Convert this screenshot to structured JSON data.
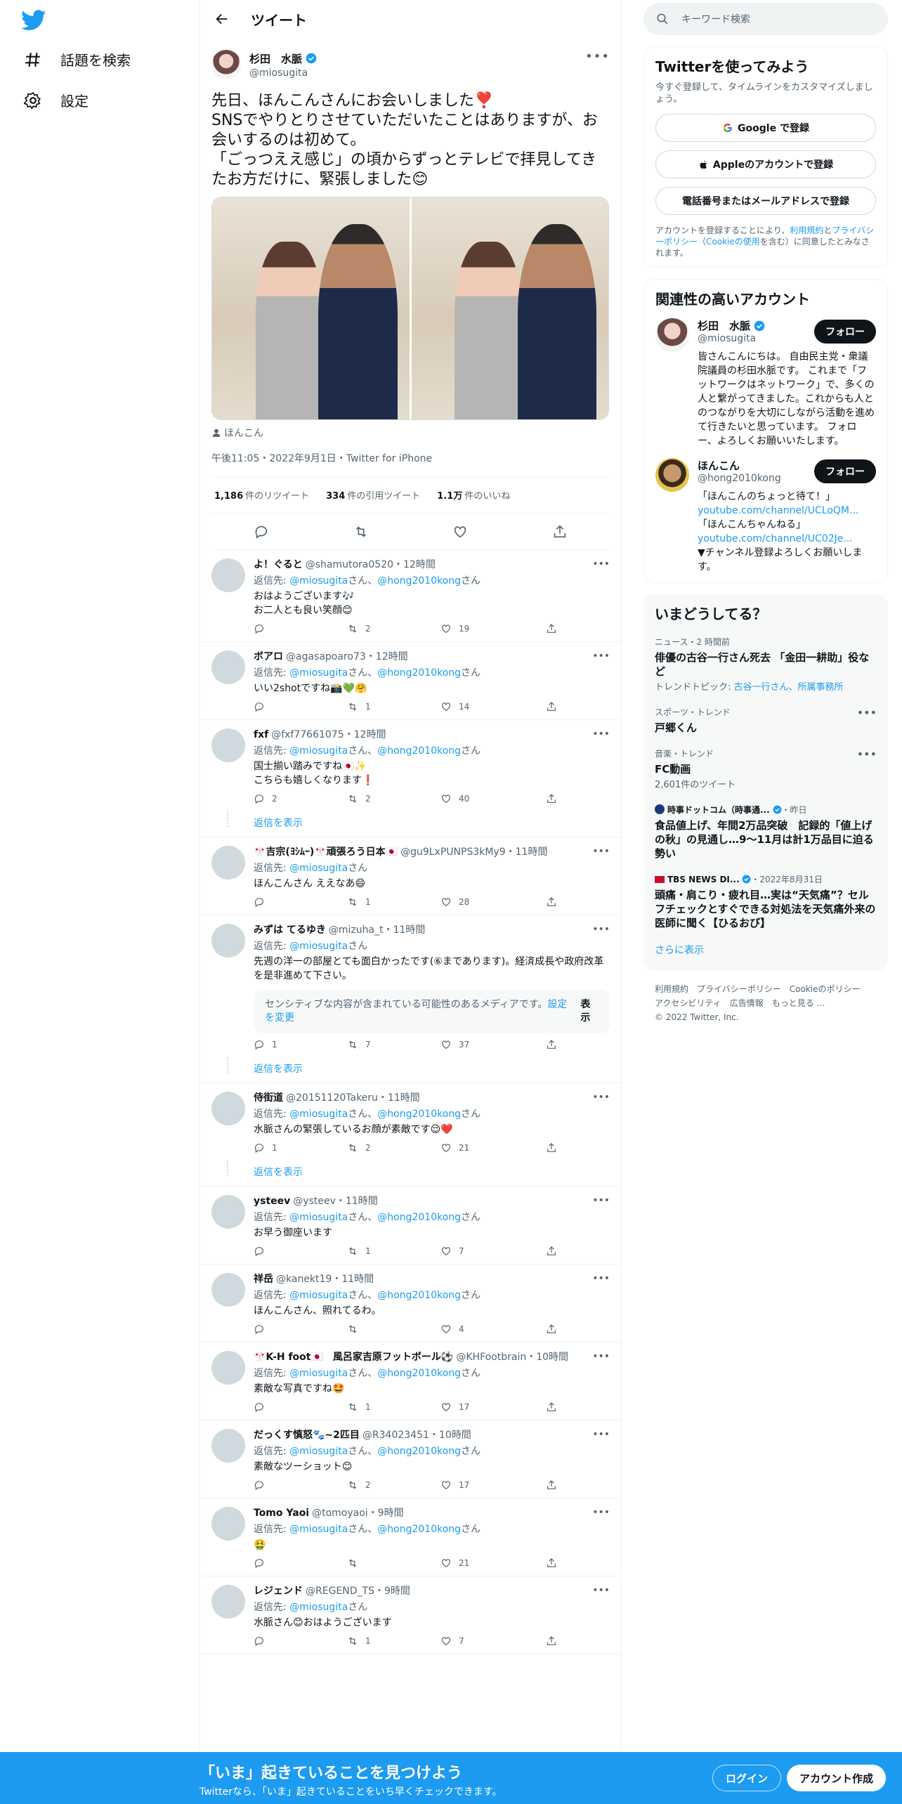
{
  "nav": {
    "explore": "話題を検索",
    "settings": "設定"
  },
  "header": {
    "title": "ツイート"
  },
  "main_tweet": {
    "name": "杉田　水脈",
    "handle": "@miosugita",
    "text": "先日、ほんこんさんにお会いしました❣️\nSNSでやりとりさせていただいたことはありますが、お会いするのは初めて。\n「ごっつええ感じ」の頃からずっとテレビで拝見してきたお方だけに、緊張しました😊",
    "tag": "ほんこん",
    "timestamp": "午後11:05・2022年9月1日・Twitter for iPhone",
    "retweets_num": "1,186",
    "retweets_label": "件のリツイート",
    "quotes_num": "334",
    "quotes_label": "件の引用ツイート",
    "likes_num": "1.1万",
    "likes_label": "件のいいね"
  },
  "replies": [
    {
      "name": "よ！ぐると",
      "handle": "@shamutora0520",
      "time": "・12時間",
      "to_prefix": "返信先:",
      "to1": "@miosugita",
      "to_sep": "さん、",
      "to2": "@hong2010kong",
      "to_suffix": "さん",
      "text": "おはようございます🎶\nお二人とも良い笑顔😊",
      "replies": "",
      "retweets": "2",
      "likes": "19"
    },
    {
      "name": "ボアロ",
      "handle": "@agasapoaro73",
      "time": "・12時間",
      "to_prefix": "返信先:",
      "to1": "@miosugita",
      "to_sep": "さん、",
      "to2": "@hong2010kong",
      "to_suffix": "さん",
      "text": "いい2shotですね📸💚🤗",
      "replies": "",
      "retweets": "1",
      "likes": "14"
    },
    {
      "name": "fxf",
      "handle": "@fxf77661075",
      "time": "・12時間",
      "to_prefix": "返信先:",
      "to1": "@miosugita",
      "to_sep": "さん、",
      "to2": "@hong2010kong",
      "to_suffix": "さん",
      "text": "国士揃い踏みですね🇯🇵✨\nこちらも嬉しくなります❗️",
      "replies": "2",
      "retweets": "2",
      "likes": "40",
      "show_more": "返信を表示"
    },
    {
      "name": "🎌吉宗(ﾖｼﾑｰ)🎌頑張ろう日本🇯🇵",
      "handle": "@gu9LxPUNPS3kMy9",
      "time": "・11時間",
      "to_prefix": "返信先:",
      "to1": "@miosugita",
      "to_suffix": "さん",
      "text": "ほんこんさん ええなあ😄",
      "replies": "",
      "retweets": "1",
      "likes": "28"
    },
    {
      "name": "みずは てるゆき",
      "handle": "@mizuha_t",
      "time": "・11時間",
      "to_prefix": "返信先:",
      "to1": "@miosugita",
      "to_suffix": "さん",
      "text": "先週の洋一の部屋とても面白かったです(⑥まであります)。経済成長や政府改革を是非進めて下さい。",
      "sensitive_text": "センシティブな内容が含まれている可能性のあるメディアです。",
      "sensitive_link": "設定を変更",
      "sensitive_btn": "表示",
      "replies": "1",
      "retweets": "7",
      "likes": "37",
      "show_more": "返信を表示"
    },
    {
      "name": "侍街道",
      "handle": "@20151120Takeru",
      "time": "・11時間",
      "to_prefix": "返信先:",
      "to1": "@miosugita",
      "to_sep": "さん、",
      "to2": "@hong2010kong",
      "to_suffix": "さん",
      "text": "水脈さんの緊張しているお顔が素敵です😌❤️",
      "replies": "1",
      "retweets": "2",
      "likes": "21",
      "show_more": "返信を表示"
    },
    {
      "name": "ysteev",
      "handle": "@ysteev",
      "time": "・11時間",
      "to_prefix": "返信先:",
      "to1": "@miosugita",
      "to_sep": "さん、",
      "to2": "@hong2010kong",
      "to_suffix": "さん",
      "text": "お早う御座います",
      "replies": "",
      "retweets": "1",
      "likes": "7"
    },
    {
      "name": "祥岳",
      "handle": "@kanekt19",
      "time": "・11時間",
      "to_prefix": "返信先:",
      "to1": "@miosugita",
      "to_sep": "さん、",
      "to2": "@hong2010kong",
      "to_suffix": "さん",
      "text": "ほんこんさん、照れてるわ。",
      "replies": "",
      "retweets": "",
      "likes": "4"
    },
    {
      "name": "🎌K-H foot🇯🇵　風呂家吉原フットボール⚽️",
      "handle": "@KHFootbrain",
      "time": "・10時間",
      "to_prefix": "返信先:",
      "to1": "@miosugita",
      "to_sep": "さん、",
      "to2": "@hong2010kong",
      "to_suffix": "さん",
      "text": "素敵な写真ですね🤩",
      "replies": "",
      "retweets": "1",
      "likes": "17"
    },
    {
      "name": "だっくす慎怒🐾~2匹目",
      "handle": "@R34023451",
      "time": "・10時間",
      "to_prefix": "返信先:",
      "to1": "@miosugita",
      "to_sep": "さん、",
      "to2": "@hong2010kong",
      "to_suffix": "さん",
      "text": "素敵なツーショット😊",
      "replies": "",
      "retweets": "2",
      "likes": "17"
    },
    {
      "name": "Tomo Yaoi",
      "handle": "@tomoyaoi",
      "time": "・9時間",
      "to_prefix": "返信先:",
      "to1": "@miosugita",
      "to_sep": "さん、",
      "to2": "@hong2010kong",
      "to_suffix": "さん",
      "text": "🤮",
      "replies": "",
      "retweets": "",
      "likes": "21"
    },
    {
      "name": "レジェンド",
      "handle": "@REGEND_TS",
      "time": "・9時間",
      "to_prefix": "返信先:",
      "to1": "@miosugita",
      "to_suffix": "さん",
      "text": "水脈さん😊おはようございます",
      "replies": "",
      "retweets": "1",
      "likes": "7"
    }
  ],
  "right": {
    "search_placeholder": "キーワード検索",
    "signup_title": "Twitterを使ってみよう",
    "signup_desc": "今すぐ登録して、タイムラインをカスタマイズしましょう。",
    "google_btn": "Google で登録",
    "apple_btn": "Appleのアカウントで登録",
    "phone_btn": "電話番号またはメールアドレスで登録",
    "terms_1": "アカウントを登録することにより、",
    "terms_link1": "利用規約",
    "terms_2": "と",
    "terms_link2": "プライバシーポリシー",
    "terms_3": "（",
    "terms_link3": "Cookieの使用",
    "terms_4": "を含む）に同意したとみなされます。",
    "related_title": "関連性の高いアカウント",
    "acc1_name": "杉田　水脈",
    "acc1_handle": "@miosugita",
    "acc1_bio": "皆さんこんにちは。 自由民主党・衆議院議員の杉田水脈です。 これまで「フットワークはネットワーク」で、多くの人と繋がってきました。これからも人とのつながりを大切にしながら活動を進めて行きたいと思っています。 フォロー、よろしくお願いいたします。",
    "acc2_name": "ほんこん",
    "acc2_handle": "@hong2010kong",
    "acc2_bio_1": "「ほんこんのちょっと待て！」",
    "acc2_link1": "youtube.com/channel/UCLoQM...",
    "acc2_bio_2": "「ほんこんちゃんねる」",
    "acc2_link2": "youtube.com/channel/UC02Je...",
    "acc2_bio_3": "▼チャンネル登録よろしくお願いします。",
    "follow_label": "フォロー",
    "trends_title": "いまどうしてる？",
    "t1_ctx": "ニュース・2 時間前",
    "t1_title": "俳優の古谷一行さん死去 「金田一耕助」役など",
    "t1_sub_label": "トレンドトピック: ",
    "t1_sub_links": "古谷一行さん、所属事務所",
    "t2_ctx": "スポーツ・トレンド",
    "t2_title": "戸郷くん",
    "t3_ctx": "音楽・トレンド",
    "t3_title": "FC動画",
    "t3_sub": "2,601件のツイート",
    "t4_source": "時事ドットコム（時事通...",
    "t4_time": "・昨日",
    "t4_title": "食品値上げ、年間2万品突破　記録的「値上げの秋」の見通し…9～11月は計1万品目に迫る勢い",
    "t5_source": "TBS NEWS DI...",
    "t5_time": "・2022年8月31日",
    "t5_title": "頭痛・肩こり・疲れ目…実は“天気痛”？セルフチェックとすぐできる対処法を天気痛外来の医師に聞く【ひるおび】",
    "show_more": "さらに表示",
    "footer": [
      "利用規約",
      "プライバシーポリシー",
      "Cookieのポリシー",
      "アクセシビリティ",
      "広告情報",
      "もっと見る ...",
      "© 2022 Twitter, Inc."
    ]
  },
  "banner": {
    "title": "「いま」起きていることを見つけよう",
    "subtitle": "Twitterなら、「いま」起きていることをいち早くチェックできます。",
    "login": "ログイン",
    "signup": "アカウント作成"
  }
}
